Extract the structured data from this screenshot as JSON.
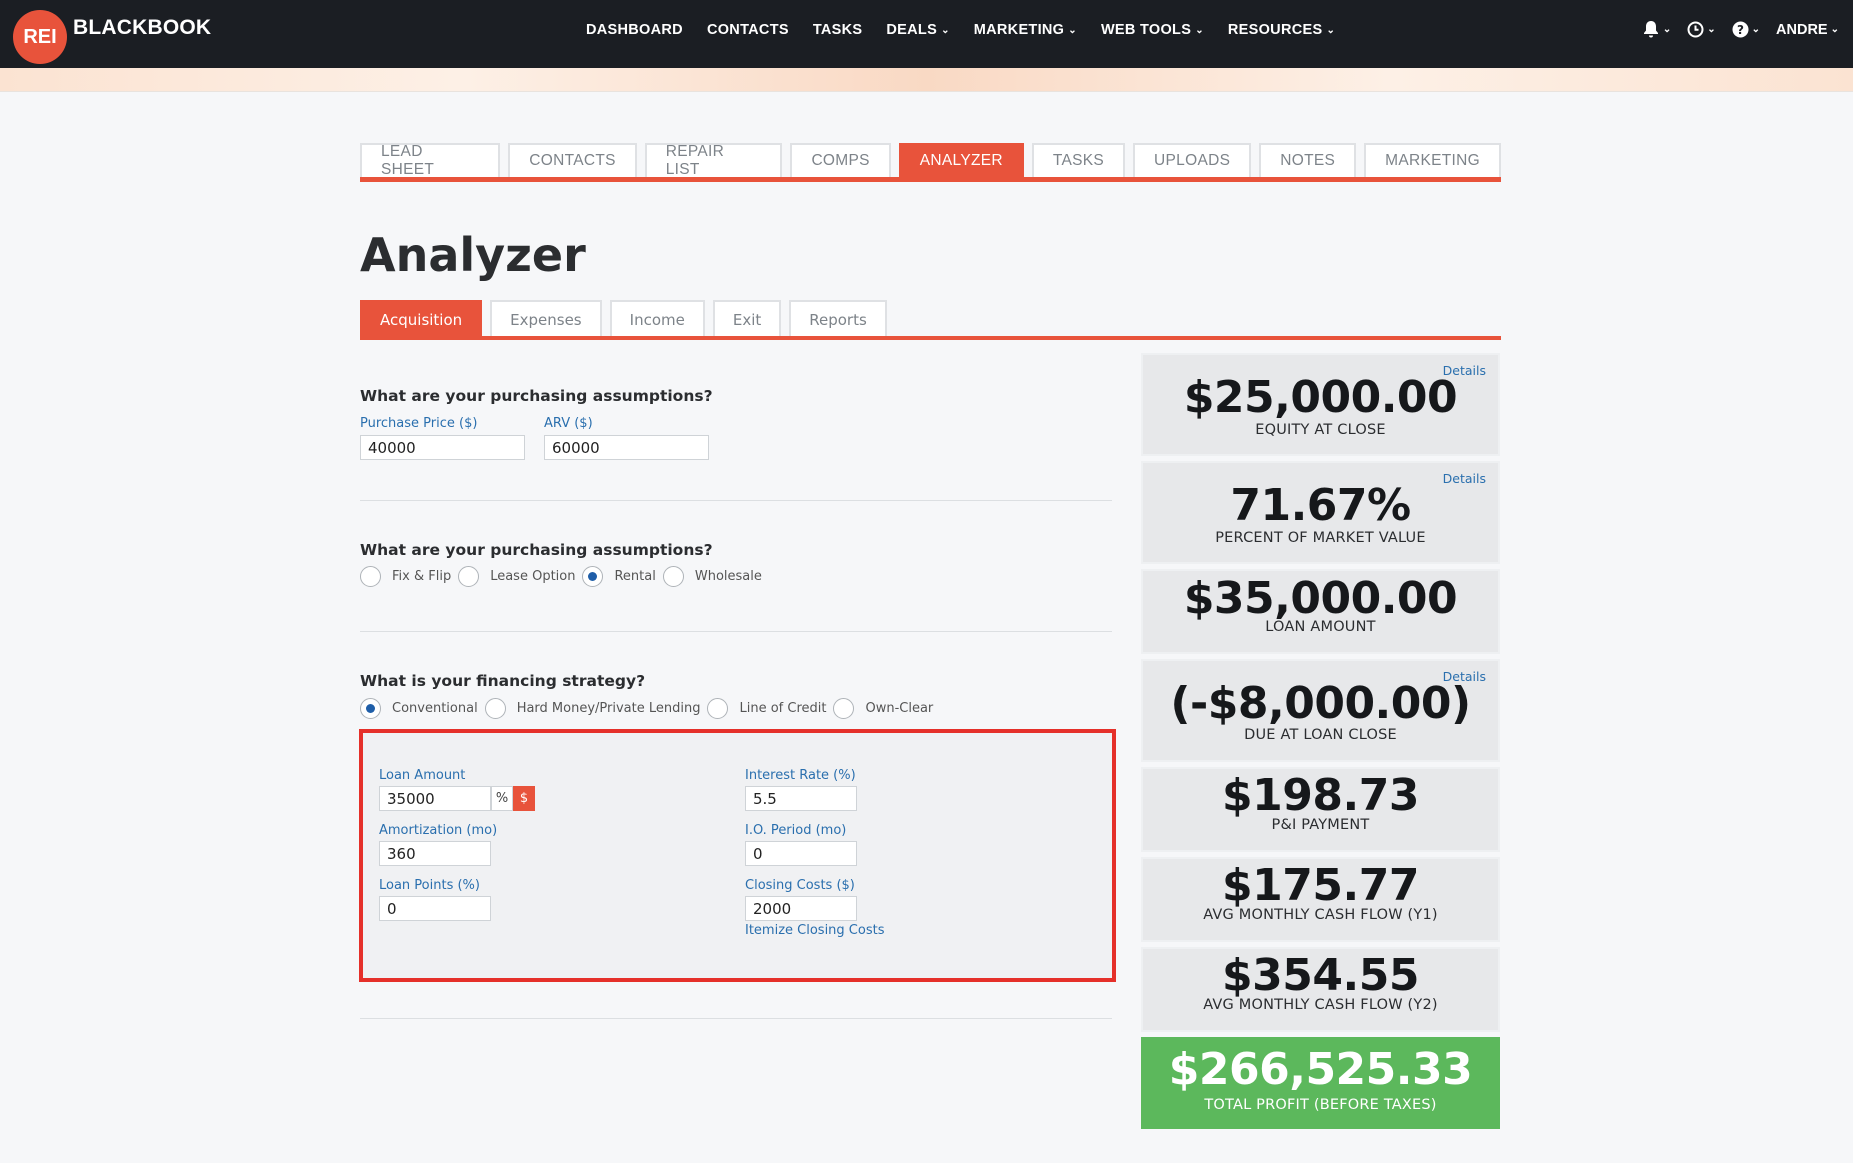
{
  "app": {
    "logo_mark": "REI",
    "logo_text": "BLACKBOOK"
  },
  "nav": {
    "items": [
      {
        "label": "DASHBOARD",
        "dropdown": false
      },
      {
        "label": "CONTACTS",
        "dropdown": false
      },
      {
        "label": "TASKS",
        "dropdown": false
      },
      {
        "label": "DEALS",
        "dropdown": true
      },
      {
        "label": "MARKETING",
        "dropdown": true
      },
      {
        "label": "WEB TOOLS",
        "dropdown": true
      },
      {
        "label": "RESOURCES",
        "dropdown": true
      }
    ],
    "user": "ANDRE",
    "icons": [
      "bell-icon",
      "clock-icon",
      "help-icon"
    ]
  },
  "main_tabs": [
    "LEAD SHEET",
    "CONTACTS",
    "REPAIR LIST",
    "COMPS",
    "ANALYZER",
    "TASKS",
    "UPLOADS",
    "NOTES",
    "MARKETING"
  ],
  "main_tab_active": "ANALYZER",
  "page_title": "Analyzer",
  "sub_tabs": [
    "Acquisition",
    "Expenses",
    "Income",
    "Exit",
    "Reports"
  ],
  "sub_tab_active": "Acquisition",
  "purchase": {
    "question": "What are your purchasing assumptions?",
    "purchase_price_label": "Purchase Price ($)",
    "purchase_price": "40000",
    "arv_label": "ARV ($)",
    "arv": "60000"
  },
  "strategy": {
    "question": "What are your purchasing assumptions?",
    "options": [
      "Fix & Flip",
      "Lease Option",
      "Rental",
      "Wholesale"
    ],
    "selected": "Rental"
  },
  "financing": {
    "question": "What is your financing strategy?",
    "options": [
      "Conventional",
      "Hard Money/Private Lending",
      "Line of Credit",
      "Own-Clear"
    ],
    "selected": "Conventional",
    "loan_amount_label": "Loan Amount",
    "loan_amount": "35000",
    "unit_percent": "%",
    "unit_dollar": "$",
    "unit_selected": "$",
    "amortization_label": "Amortization (mo)",
    "amortization": "360",
    "loan_points_label": "Loan Points (%)",
    "loan_points": "0",
    "interest_rate_label": "Interest Rate (%)",
    "interest_rate": "5.5",
    "io_period_label": "I.O. Period (mo)",
    "io_period": "0",
    "closing_costs_label": "Closing Costs ($)",
    "closing_costs": "2000",
    "itemize_link": "Itemize Closing Costs"
  },
  "summary": {
    "details_label": "Details",
    "equity_value": "$25,000.00",
    "equity_caption": "EQUITY AT CLOSE",
    "pmv_value": "71.67%",
    "pmv_caption": "PERCENT OF MARKET VALUE",
    "loan_value": "$35,000.00",
    "loan_caption": "LOAN AMOUNT",
    "due_value": "(-$8,000.00)",
    "due_caption": "DUE AT LOAN CLOSE",
    "pi_value": "$198.73",
    "pi_caption": "P&I PAYMENT",
    "cf1_value": "$175.77",
    "cf1_caption": "AVG MONTHLY CASH FLOW (Y1)",
    "cf2_value": "$354.55",
    "cf2_caption": "AVG MONTHLY CASH FLOW (Y2)",
    "profit_value": "$266,525.33",
    "profit_caption": "TOTAL PROFIT (BEFORE TAXES)"
  },
  "colors": {
    "accent": "#e8533b",
    "link": "#2a6fae",
    "profit": "#5cb85c",
    "highlight_border": "#e5302a",
    "topbar": "#1b1e23"
  }
}
